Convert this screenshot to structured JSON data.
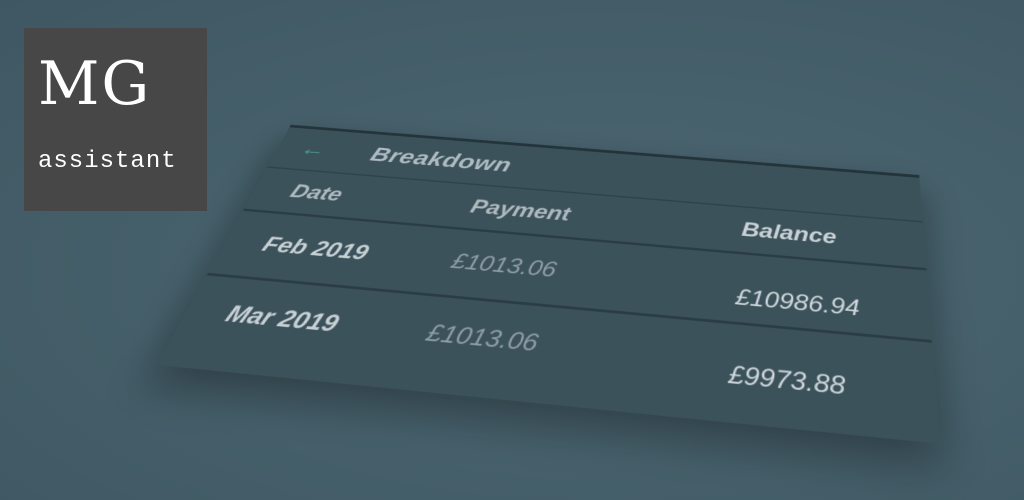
{
  "logo": {
    "mark": "MG",
    "sub": "assistant"
  },
  "screen": {
    "title": "Breakdown",
    "back_icon": "arrow-left-icon",
    "columns": [
      "Date",
      "Payment",
      "Balance"
    ],
    "rows": [
      {
        "date": "Feb 2019",
        "payment": "£1013.06",
        "balance": "£10986.94"
      },
      {
        "date": "Mar 2019",
        "payment": "£1013.06",
        "balance": "£9973.88"
      }
    ]
  },
  "colors": {
    "background": "#46606c",
    "card": "#3c525b",
    "logo_bg": "#474747",
    "accent": "#4d9a8c"
  }
}
